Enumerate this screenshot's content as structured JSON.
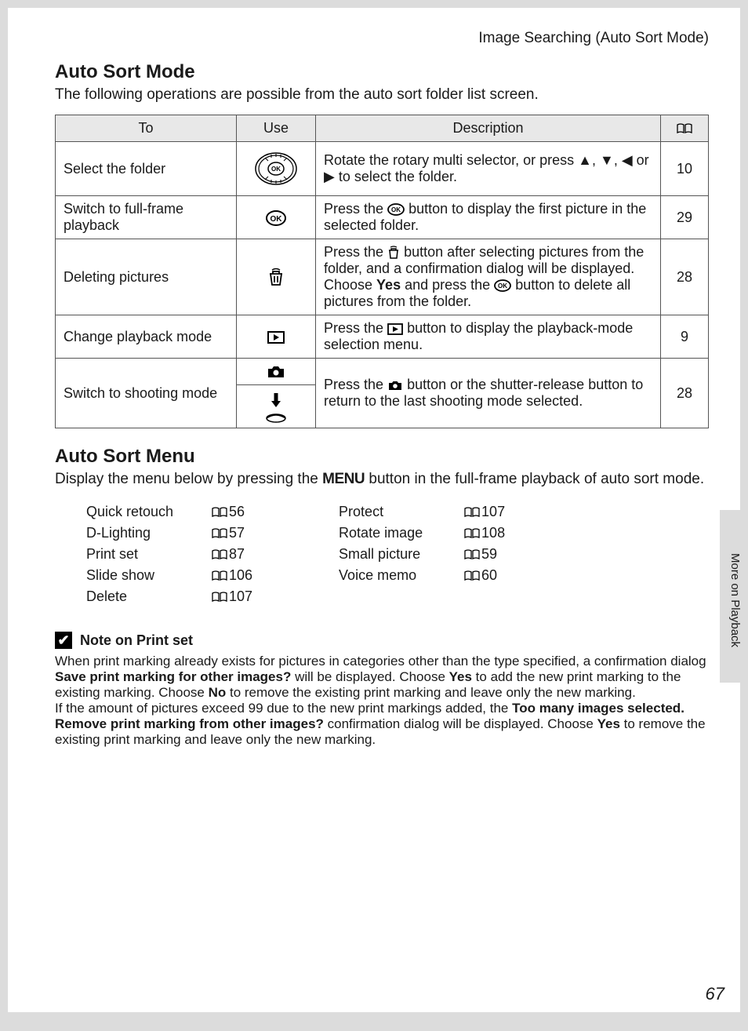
{
  "breadcrumb": "Image Searching (Auto Sort Mode)",
  "h1": "Auto Sort Mode",
  "intro": "The following operations are possible from the auto sort folder list screen.",
  "headers": {
    "to": "To",
    "use": "Use",
    "desc": "Description"
  },
  "rows": [
    {
      "to": "Select the folder",
      "desc_before": "Rotate the rotary multi selector, or press ",
      "desc_after": " to select the folder.",
      "page": "10"
    },
    {
      "to": "Switch to full-frame playback",
      "desc_a": "Press the ",
      "desc_b": " button to display the first picture in the selected folder.",
      "page": "29"
    },
    {
      "to": "Deleting pictures",
      "d1": "Press the ",
      "d2": " button after selecting pictures from the folder, and a confirmation dialog will be displayed.",
      "d3": "Choose ",
      "d3b": "Yes",
      "d4": " and press the ",
      "d5": " button to delete all pictures from the folder.",
      "page": "28"
    },
    {
      "to": "Change playback mode",
      "d1": "Press the ",
      "d2": " button to display the playback-mode selection menu.",
      "page": "9"
    },
    {
      "to": "Switch to shooting mode",
      "d1": "Press the ",
      "d2": " button or the shutter-release button to return to the last shooting mode selected.",
      "page": "28"
    }
  ],
  "h2": "Auto Sort Menu",
  "intro2a": "Display the menu below by pressing the ",
  "intro2b": " button in the full-frame playback of auto sort mode.",
  "menu_word": "MENU",
  "menu_left": [
    {
      "label": "Quick retouch",
      "page": "56"
    },
    {
      "label": "D-Lighting",
      "page": "57"
    },
    {
      "label": "Print set",
      "page": "87"
    },
    {
      "label": "Slide show",
      "page": "106"
    },
    {
      "label": "Delete",
      "page": "107"
    }
  ],
  "menu_right": [
    {
      "label": "Protect",
      "page": "107"
    },
    {
      "label": "Rotate image",
      "page": "108"
    },
    {
      "label": "Small picture",
      "page": "59"
    },
    {
      "label": "Voice memo",
      "page": "60"
    }
  ],
  "note_title": "Note on Print set",
  "note_p1_a": "When print marking already exists for pictures in categories other than the type specified, a confirmation dialog ",
  "note_p1_b": "Save print marking for other images?",
  "note_p1_c": " will be displayed. Choose ",
  "note_p1_d": "Yes",
  "note_p1_e": " to add the new print marking to the existing marking. Choose ",
  "note_p1_f": "No",
  "note_p1_g": " to remove the existing print marking and leave only the new marking.",
  "note_p2_a": "If the amount of pictures exceed 99 due to the new print markings added, the ",
  "note_p2_b": "Too many images selected. Remove print marking from other images?",
  "note_p2_c": " confirmation dialog will be displayed. Choose ",
  "note_p2_d": "Yes",
  "note_p2_e": " to remove the existing print marking and leave only the new marking.",
  "side_tab": "More on Playback",
  "page_num": "67"
}
